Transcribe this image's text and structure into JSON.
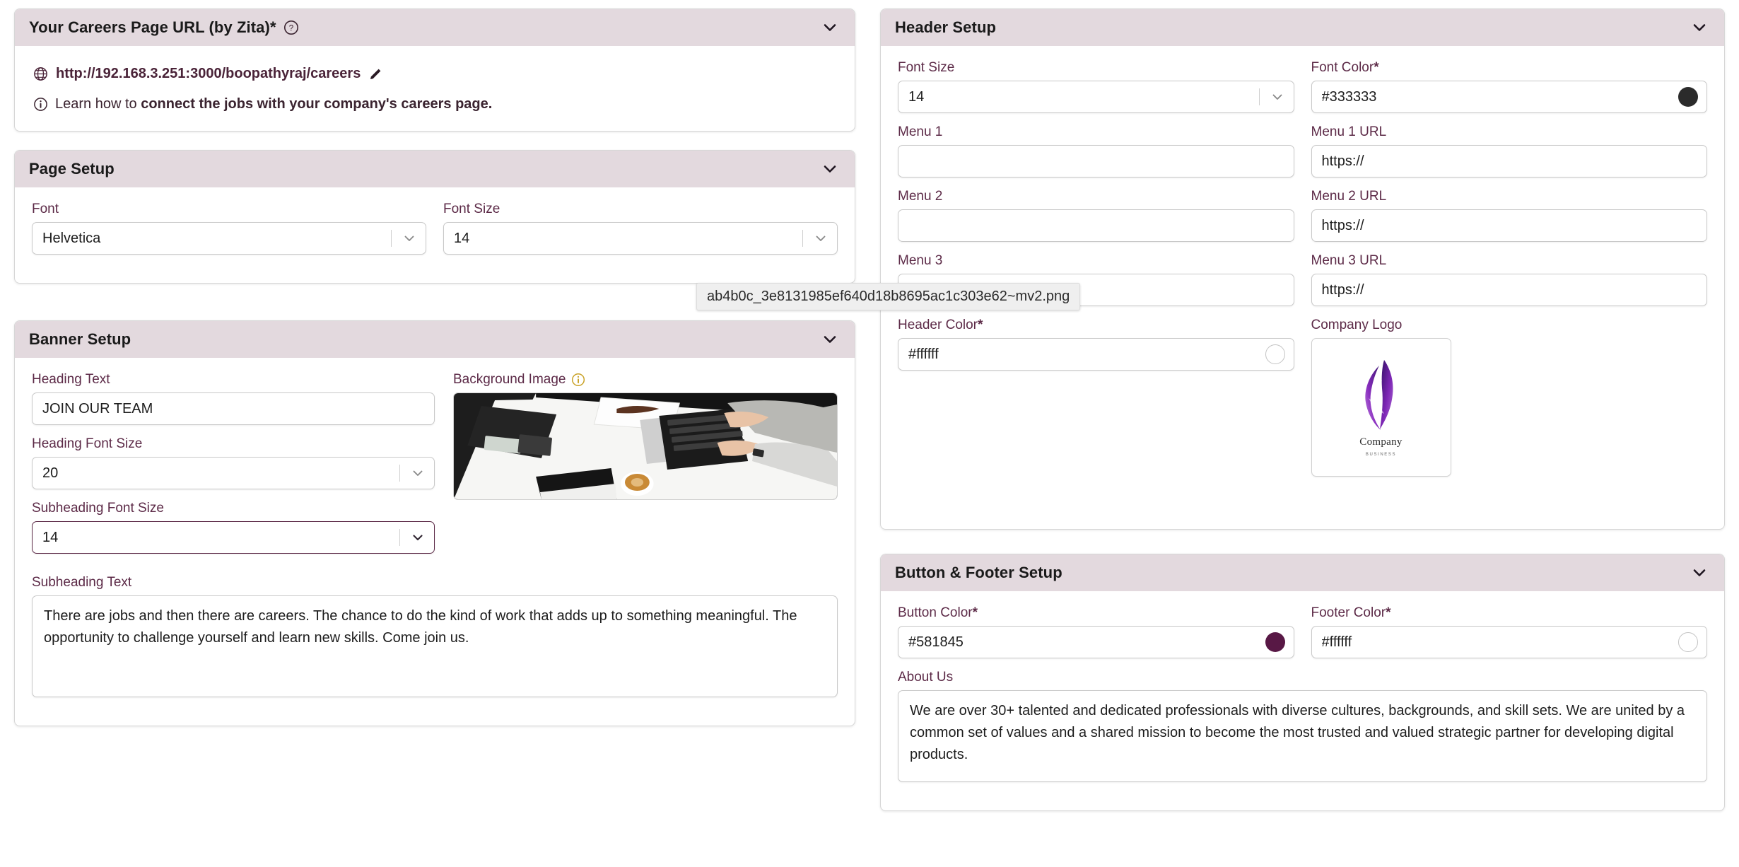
{
  "careers_url_panel": {
    "title": "Your Careers Page URL (by Zita)",
    "required_mark": "*",
    "help_icon": "question-circle-icon",
    "collapse_icon": "chevron-down-icon",
    "globe_icon": "globe-icon",
    "url": "http://192.168.3.251:3000/boopathyraj/careers",
    "edit_icon": "pencil-icon",
    "info_icon": "info-circle-icon",
    "learn_prefix": "Learn how to ",
    "learn_link": "connect the jobs with your company's careers page."
  },
  "page_setup": {
    "title": "Page Setup",
    "collapse_icon": "chevron-down-icon",
    "font_label": "Font",
    "font_value": "Helvetica",
    "font_size_label": "Font Size",
    "font_size_value": "14"
  },
  "banner_setup": {
    "title": "Banner Setup",
    "collapse_icon": "chevron-down-icon",
    "heading_text_label": "Heading Text",
    "heading_text_value": "JOIN OUR TEAM",
    "heading_font_size_label": "Heading Font Size",
    "heading_font_size_value": "20",
    "subheading_font_size_label": "Subheading Font Size",
    "subheading_font_size_value": "14",
    "subheading_text_label": "Subheading Text",
    "subheading_text_value": "There are jobs and then there are careers. The chance to do the kind of work that adds up to something meaningful. The opportunity to challenge yourself and learn new skills. Come join us.",
    "background_image_label": "Background Image",
    "background_image_info_icon": "info-circle-icon",
    "background_image_alt": "desk-with-laptop-keyboard-phone-and-coffee"
  },
  "header_setup": {
    "title": "Header Setup",
    "collapse_icon": "chevron-down-icon",
    "font_size_label": "Font Size",
    "font_size_value": "14",
    "font_color_label": "Font Color",
    "font_color_required": "*",
    "font_color_value": "#333333",
    "font_color_swatch": "#2b2b2b",
    "menu1_label": "Menu 1",
    "menu1_value": "",
    "menu1_url_label": "Menu 1 URL",
    "menu1_url_value": "https://",
    "menu2_label": "Menu 2",
    "menu2_value": "",
    "menu2_url_label": "Menu 2 URL",
    "menu2_url_value": "https://",
    "menu3_label": "Menu 3",
    "menu3_value": "",
    "menu3_url_label": "Menu 3 URL",
    "menu3_url_value": "https://",
    "header_color_label": "Header Color",
    "header_color_required": "*",
    "header_color_value": "#ffffff",
    "header_color_swatch": "#ffffff",
    "company_logo_label": "Company Logo",
    "company_logo_caption": "Company",
    "company_logo_tagline": "BUSINESS"
  },
  "button_footer_setup": {
    "title": "Button & Footer Setup",
    "collapse_icon": "chevron-down-icon",
    "button_color_label": "Button Color",
    "button_color_required": "*",
    "button_color_value": "#581845",
    "button_color_swatch": "#581845",
    "footer_color_label": "Footer Color",
    "footer_color_required": "*",
    "footer_color_value": "#ffffff",
    "footer_color_swatch": "#ffffff",
    "about_us_label": "About Us",
    "about_us_value": "We are over 30+ talented and dedicated professionals with diverse cultures, backgrounds, and skill sets. We are united by a common set of values and a shared mission to become the most trusted and valued strategic partner for developing digital products."
  },
  "tooltip": {
    "text": "ab4b0c_3e8131985ef640d18b8695ac1c303e62~mv2.png"
  },
  "colors": {
    "panel_header_bg": "#e3d9de",
    "label_text": "#5c2a47",
    "accent_dark": "#4a2338",
    "button_color": "#581845",
    "info_gold": "#c9a227"
  }
}
